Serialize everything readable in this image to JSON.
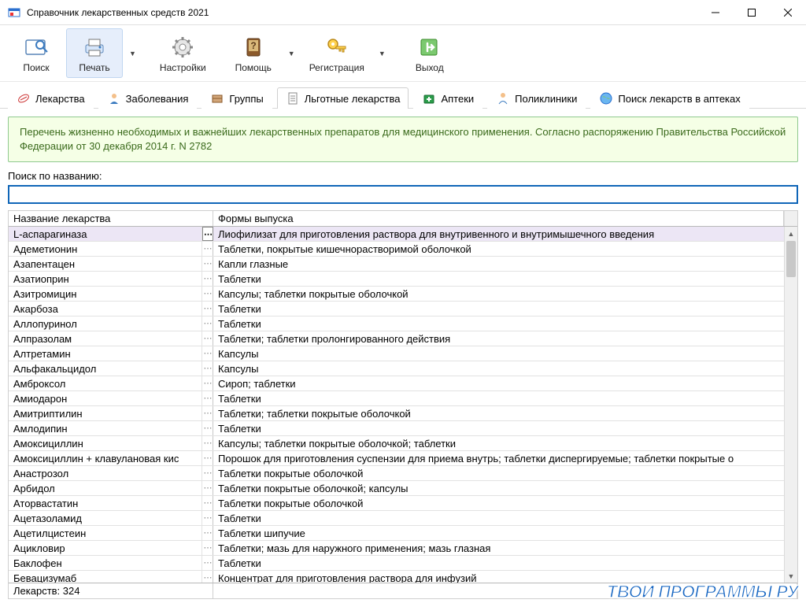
{
  "window": {
    "title": "Справочник лекарственных средств 2021"
  },
  "toolbar": {
    "search": "Поиск",
    "print": "Печать",
    "settings": "Настройки",
    "help": "Помощь",
    "register": "Регистрация",
    "exit": "Выход"
  },
  "tabs": {
    "items": [
      {
        "label": "Лекарства"
      },
      {
        "label": "Заболевания"
      },
      {
        "label": "Группы"
      },
      {
        "label": "Льготные лекарства"
      },
      {
        "label": "Аптеки"
      },
      {
        "label": "Поликлиники"
      },
      {
        "label": "Поиск лекарств в аптеках"
      }
    ],
    "active_index": 3
  },
  "banner": {
    "text": "Перечень жизненно необходимых и важнейших лекарственных препаратов для медицинского применения. Согласно распоряжению Правительства Российской Федерации от 30 декабря 2014 г. N 2782"
  },
  "search": {
    "label": "Поиск по названию:",
    "value": ""
  },
  "grid": {
    "columns": {
      "name": "Название лекарства",
      "form": "Формы выпуска"
    },
    "rows": [
      {
        "name": "L-аспарагиназа",
        "form": "Лиофилизат для приготовления раствора для внутривенного и внутримышечного введения",
        "selected": true
      },
      {
        "name": "Адеметионин",
        "form": "Таблетки, покрытые кишечнорастворимой оболочкой"
      },
      {
        "name": "Азапентацен",
        "form": "Капли глазные"
      },
      {
        "name": "Азатиоприн",
        "form": "Таблетки"
      },
      {
        "name": "Азитромицин",
        "form": "Капсулы; таблетки покрытые оболочкой"
      },
      {
        "name": "Акарбоза",
        "form": "Таблетки"
      },
      {
        "name": "Аллопуринол",
        "form": "Таблетки"
      },
      {
        "name": "Алпразолам",
        "form": "Таблетки; таблетки пролонгированного действия"
      },
      {
        "name": "Алтретамин",
        "form": "Капсулы"
      },
      {
        "name": "Альфакальцидол",
        "form": "Капсулы"
      },
      {
        "name": "Амброксол",
        "form": "Сироп; таблетки"
      },
      {
        "name": "Амиодарон",
        "form": "Таблетки"
      },
      {
        "name": "Амитриптилин",
        "form": "Таблетки; таблетки покрытые оболочкой"
      },
      {
        "name": "Амлодипин",
        "form": "Таблетки"
      },
      {
        "name": "Амоксициллин",
        "form": "Капсулы; таблетки покрытые оболочкой; таблетки"
      },
      {
        "name": "Амоксициллин + клавулановая кис",
        "form": "Порошок для приготовления суспензии для приема внутрь; таблетки диспергируемые; таблетки покрытые о"
      },
      {
        "name": "Анастрозол",
        "form": "Таблетки покрытые оболочкой"
      },
      {
        "name": "Арбидол",
        "form": "Таблетки покрытые оболочкой; капсулы"
      },
      {
        "name": "Аторвастатин",
        "form": "Таблетки покрытые оболочкой"
      },
      {
        "name": "Ацетазоламид",
        "form": "Таблетки"
      },
      {
        "name": "Ацетилцистеин",
        "form": "Таблетки шипучие"
      },
      {
        "name": "Ацикловир",
        "form": "Таблетки; мазь для наружного применения; мазь глазная"
      },
      {
        "name": "Баклофен",
        "form": "Таблетки"
      },
      {
        "name": "Бевацизумаб",
        "form": "Концентрат для приготовления раствора для инфузий"
      }
    ],
    "footer": "Лекарств: 324"
  },
  "watermark": "ТВОИ ПРОГРАММЫ РУ"
}
